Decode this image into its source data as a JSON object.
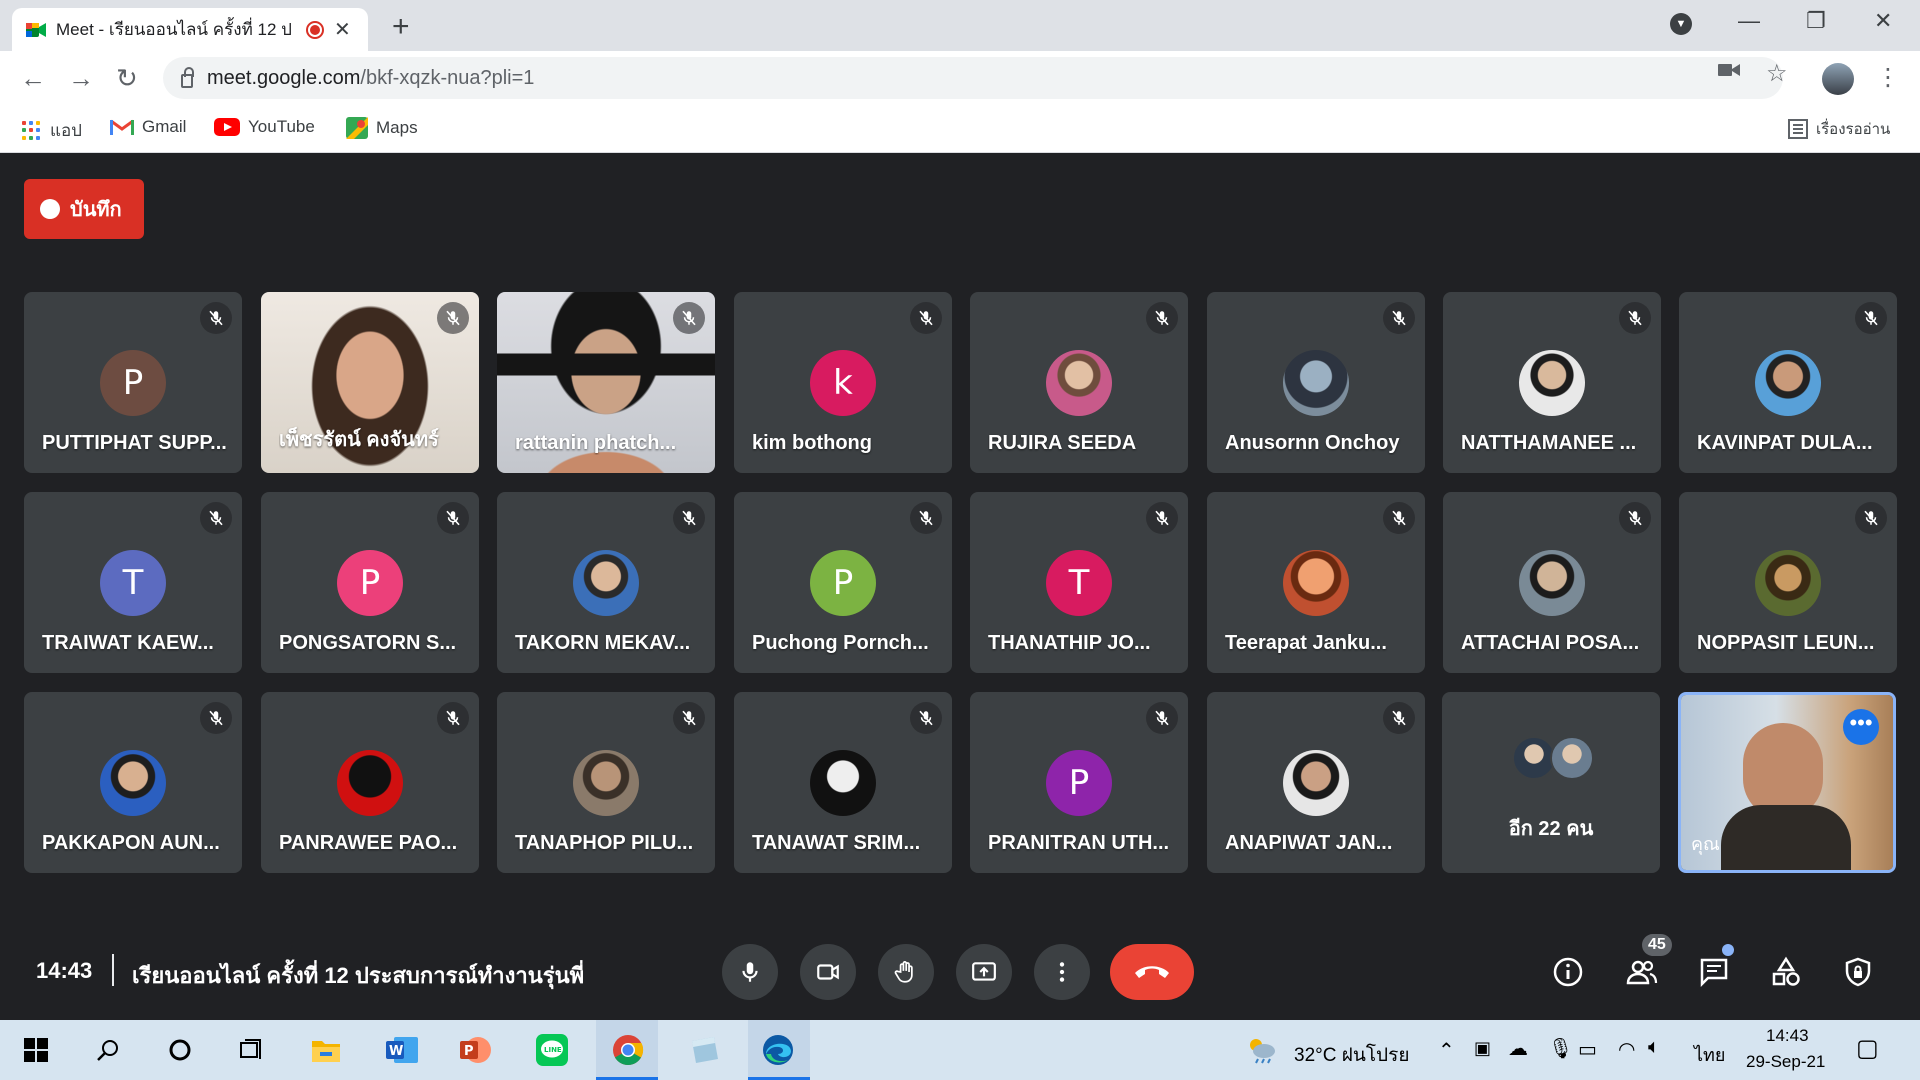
{
  "browser": {
    "tab_title": "Meet - เรียนออนไลน์ ครั้งที่ 12 ป",
    "tab_close": "✕",
    "new_tab": "+",
    "url_host": "meet.google.com",
    "url_path": "/bkf-xqzk-nua?pli=1",
    "bookmarks": {
      "apps": "แอป",
      "gmail": "Gmail",
      "youtube": "YouTube",
      "maps": "Maps",
      "reading_list": "เรื่องรออ่าน"
    }
  },
  "meet": {
    "record_label": "บันทึก",
    "participants": [
      {
        "name": "PUTTIPHAT SUPP...",
        "initial": "P",
        "color": "#6d4c41"
      },
      {
        "name": "เพ็ชรรัตน์ คงจันทร์",
        "video": true
      },
      {
        "name": "rattanin phatch...",
        "video": true
      },
      {
        "name": "kim bothong",
        "initial": "k",
        "color": "#d81b60"
      },
      {
        "name": "RUJIRA SEEDA",
        "photo": true
      },
      {
        "name": "Anusornn Onchoy",
        "photo": true
      },
      {
        "name": "NATTHAMANEE ...",
        "photo": true
      },
      {
        "name": "KAVINPAT DULA...",
        "photo": true
      },
      {
        "name": "TRAIWAT KAEW...",
        "initial": "T",
        "color": "#5c6bc0"
      },
      {
        "name": "PONGSATORN S...",
        "initial": "P",
        "color": "#ec407a"
      },
      {
        "name": "TAKORN MEKAV...",
        "photo": true
      },
      {
        "name": "Puchong Pornch...",
        "initial": "P",
        "color": "#7cb342"
      },
      {
        "name": "THANATHIP JO...",
        "initial": "T",
        "color": "#d81b60"
      },
      {
        "name": "Teerapat Janku...",
        "photo": true
      },
      {
        "name": "ATTACHAI POSA...",
        "photo": true
      },
      {
        "name": "NOPPASIT LEUN...",
        "photo": true
      },
      {
        "name": "PAKKAPON AUN...",
        "photo": true
      },
      {
        "name": "PANRAWEE PAO...",
        "photo": true
      },
      {
        "name": "TANAPHOP PILU...",
        "photo": true
      },
      {
        "name": "TANAWAT SRIM...",
        "photo": true
      },
      {
        "name": "PRANITRAN UTH...",
        "initial": "P",
        "color": "#8e24aa"
      },
      {
        "name": "ANAPIWAT JAN...",
        "photo": true
      }
    ],
    "more_people": "อีก 22 คน",
    "self_label": "คุณ",
    "more_options_dots": "•••",
    "time": "14:43",
    "meeting_title": "เรียนออนไลน์ ครั้งที่ 12 ประสบการณ์ทำงานรุ่นพี่",
    "participant_count": "45"
  },
  "taskbar": {
    "weather": "32°C  ฝนโปรย",
    "language": "ไทย",
    "clock_time": "14:43",
    "clock_date": "29-Sep-21"
  }
}
